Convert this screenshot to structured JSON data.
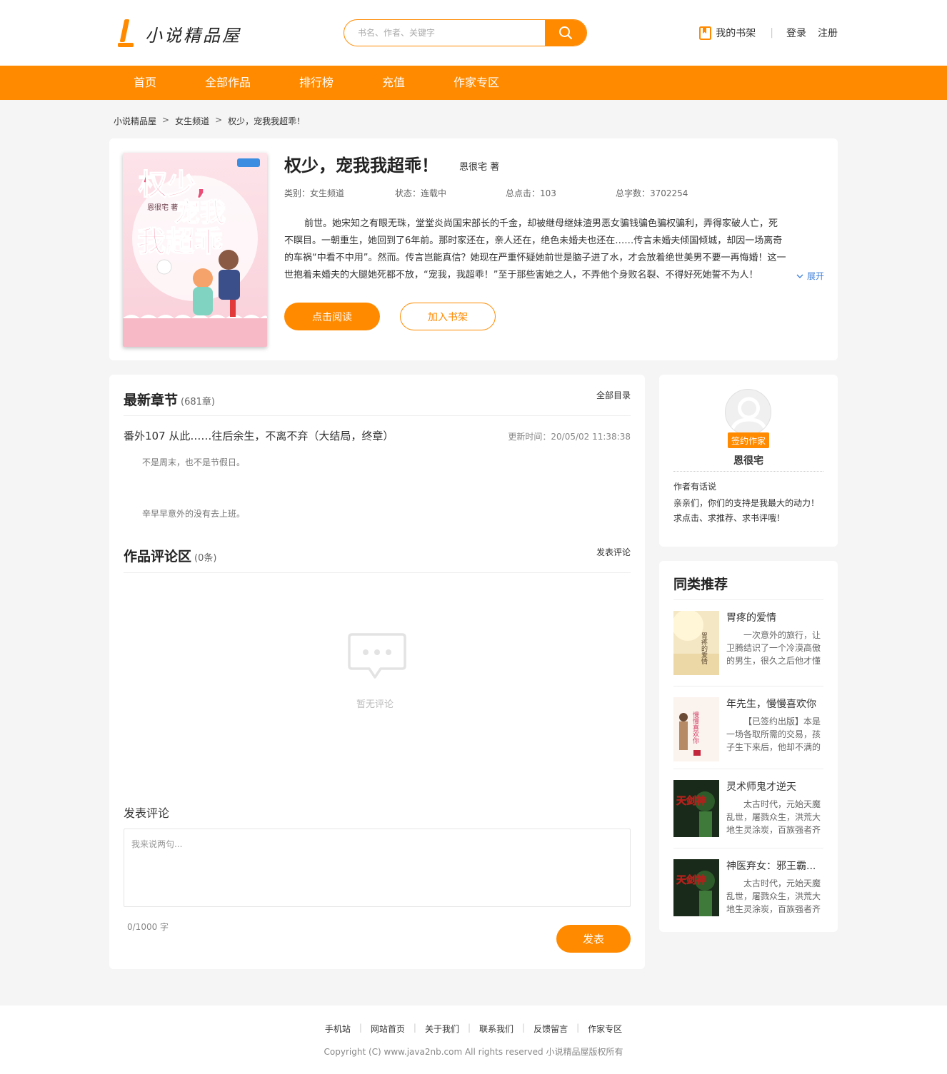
{
  "header": {
    "logo_text": "小说精品屋",
    "search_placeholder": "书名、作者、关键字",
    "bookshelf_label": "我的书架",
    "separator": "|",
    "login_label": "登录",
    "register_label": "注册"
  },
  "nav": {
    "items": [
      "首页",
      "全部作品",
      "排行榜",
      "充值",
      "作家专区"
    ]
  },
  "breadcrumb": {
    "items": [
      "小说精品屋",
      "女生频道",
      "权少，宠我我超乖！"
    ],
    "separator": ">"
  },
  "book": {
    "title": "权少，宠我我超乖！",
    "author": "恩很宅 著",
    "category": "类别：女生频道",
    "status": "状态：连载中",
    "clicks": "总点击：103",
    "word_count": "总字数：3702254",
    "intro": "前世。她宋知之有眼无珠，堂堂炎尚国宋部长的千金，却被继母继妹渣男恶女骗钱骗色骗权骗利，弄得家破人亡，死不瞑目。一朝重生，她回到了6年前。那时家还在，亲人还在，绝色未婚夫也还在……传言未婚夫倾国倾城，却因一场离奇的车祸“中看不中用”。然而。传言岂能真信？她现在严重怀疑她前世是脑子进了水，才会放着绝世美男不要一再悔婚！这一世抱着未婚夫的大腿她死都不放，“宠我，我超乖！”至于那些害她之人，不弄他个身败名裂、不得好死她誓不为人！",
    "expand_label": "展开",
    "read_button": "点击阅读",
    "shelf_button": "加入书架",
    "cover_text": [
      "权少,",
      "宠我",
      "我超乖"
    ],
    "cover_author": "恩很宅 著"
  },
  "latest": {
    "title": "最新章节",
    "count": "(681章)",
    "all_link": "全部目录",
    "chapter_title": "番外107 从此……往后余生，不离不弃（大结局，终章）",
    "update_time": "更新时间：20/05/02 11:38:38",
    "lines": [
      "不是周末，也不是节假日。",
      "辛早早意外的没有去上班。"
    ]
  },
  "comments": {
    "title": "作品评论区",
    "count": "(0条)",
    "post_link": "发表评论",
    "empty_text": "暂无评论",
    "form_label": "发表评论",
    "placeholder": "我来说两句...",
    "word_count": "0/1000 字",
    "submit": "发表"
  },
  "author_card": {
    "badge": "签约作家",
    "name": "恩很宅",
    "say_label": "作者有话说",
    "say": "亲亲们，你们的支持是我最大的动力！求点击、求推荐、求书评哦！"
  },
  "recommend": {
    "title": "同类推荐",
    "items": [
      {
        "name": "胃疼的爱情",
        "desc": "一次意外的旅行，让卫腾结识了一个冷漠高傲的男生，很久之后他才懂",
        "cover_text": "胃疼的爱情"
      },
      {
        "name": "年先生，慢慢喜欢你",
        "desc": "【已签约出版】本是一场各取所需的交易，孩子生下来后，他却不满的",
        "cover_text": "慢慢喜欢你"
      },
      {
        "name": "灵术师鬼才逆天",
        "desc": "太古时代，元始天魔乱世，屠戮众生，洪荒大地生灵涂炭，百族强者齐",
        "cover_text": "天剑神"
      },
      {
        "name": "神医弃女：邪王霸...",
        "desc": "太古时代，元始天魔乱世，屠戮众生，洪荒大地生灵涂炭，百族强者齐",
        "cover_text": "天剑神"
      }
    ]
  },
  "footer": {
    "links": [
      "手机站",
      "网站首页",
      "关于我们",
      "联系我们",
      "反馈留言",
      "作家专区"
    ],
    "separator": "|",
    "copyright": "Copyright (C) www.java2nb.com All rights reserved  小说精品屋版权所有"
  },
  "colors": {
    "accent": "#ff8a00",
    "link_blue": "#3b7ed8",
    "page_bg": "#f5f5f5"
  },
  "icons": [
    "search-icon",
    "bookshelf-icon",
    "chevron-down-icon",
    "comment-bubble-icon",
    "avatar-placeholder-icon"
  ]
}
